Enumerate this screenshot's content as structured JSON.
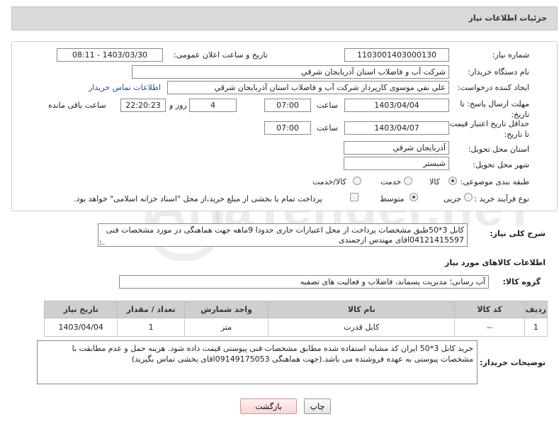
{
  "header": {
    "title": "جزئیات اطلاعات نیاز"
  },
  "form": {
    "need_number_label": "شماره نیاز:",
    "need_number": "1103001403000130",
    "announce_label": "تاریخ و ساعت اعلان عمومی:",
    "announce_value": "1403/03/30 - 08:11",
    "buyer_org_label": "نام دستگاه خریدار:",
    "buyer_org": "شرکت آب و فاضلاب استان آذربایجان شرقي",
    "creator_label": "ایجاد کننده درخواست:",
    "creator": "علي نقي موسوی کارپرداز شرکت آب و فاضلاب استان آذربایجان شرقي",
    "contact_link": "اطلاعات تماس خریدار",
    "deadline_label": "مهلت ارسال پاسخ: تا تاریخ:",
    "deadline_date": "1403/04/04",
    "time_label": "ساعت",
    "deadline_time": "07:00",
    "days_value": "4",
    "days_label": "روز و",
    "remain_time": "22:20:23",
    "remain_label": "ساعت باقی مانده",
    "price_valid_label": "حداقل تاریخ اعتبار قیمت: تا تاریخ:",
    "price_valid_date": "1403/04/07",
    "price_valid_time": "07:00",
    "province_label": "استان محل تحویل:",
    "province": "آذربایجان شرقي",
    "city_label": "شهر محل تحویل:",
    "city": "شبستر",
    "category_label": "طبقه بندی موضوعی:",
    "category_options": [
      "کالا",
      "خدمت",
      "کالا/خدمت"
    ],
    "process_label": "نوع فرآیند خرید :",
    "process_options": [
      "جزیی",
      "متوسط"
    ],
    "process_note": "پرداخت تمام یا بخشی از مبلغ خرید،از محل \"اسناد خزانه اسلامی\" خواهد بود."
  },
  "description": {
    "label": "شرح کلی نیاز:",
    "text": "کابل 3*50طبق مشخصات پرداخت از محل اعتبارات جاری حدودا 9ماهه جهت هماهنگی در مورد مشخصات فنی 04121415597اقای مهندس ازجمندی"
  },
  "goods_info_title": "اطلاعات کالاهای مورد نیاز",
  "goods_group": {
    "label": "گروه کالا:",
    "value": "آب رسانی؛ مدیریت پسماند، فاضلاب و فعالیت های تصفیه"
  },
  "table": {
    "headers": [
      "ردیف",
      "کد کالا",
      "نام کالا",
      "واحد شمارش",
      "تعداد / مقدار",
      "تاریخ نیاز"
    ],
    "rows": [
      [
        "1",
        "--",
        "کابل قدرت",
        "متر",
        "1",
        "1403/04/04"
      ]
    ]
  },
  "buyer_notes": {
    "label": "توضیحات خریدار:",
    "text": "خرید کابل 3*50    ایران کد مشابه استفاده شده مطابق مشخصات فنی پیوستی قیمت داده شود. هزینه حمل و عدم مطابقت با مشخصات پیوستی به عهده فروشنده می باشد.(جهت هماهنگی 09149175053اقای بخشی تماس بگیرید)"
  },
  "buttons": {
    "print": "چاپ",
    "back": "بازگشت"
  },
  "watermark": "AriaTender.neT"
}
